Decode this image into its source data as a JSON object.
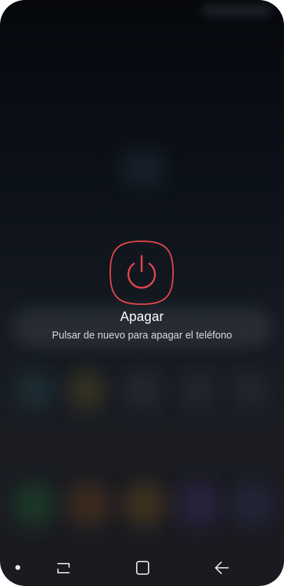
{
  "power_menu": {
    "title": "Apagar",
    "hint": "Pulsar de nuevo para apagar el teléfono",
    "icon": "power-icon",
    "accent_color": "#e0464b"
  },
  "navigation_bar": {
    "items": [
      {
        "name": "dock-dot",
        "icon": "dot-icon"
      },
      {
        "name": "recents",
        "icon": "recents-icon"
      },
      {
        "name": "home",
        "icon": "home-icon"
      },
      {
        "name": "back",
        "icon": "back-arrow-icon"
      }
    ]
  },
  "colors": {
    "background_top": "#06080d",
    "background_bottom": "#1a1a20",
    "text_primary": "#ffffff",
    "text_secondary": "#d8dadd"
  }
}
